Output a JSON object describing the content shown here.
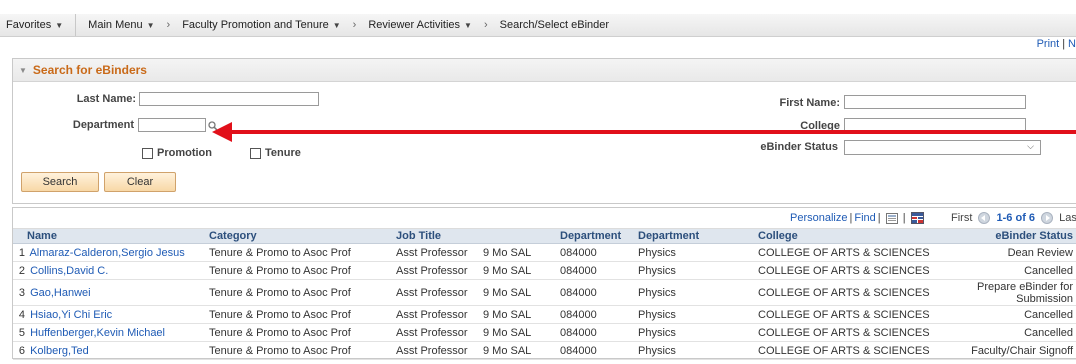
{
  "nav": {
    "favorites": "Favorites",
    "main_menu": "Main Menu",
    "crumbs": [
      "Faculty Promotion and Tenure",
      "Reviewer Activities",
      "Search/Select eBinder"
    ]
  },
  "print_bar": {
    "print": "Print",
    "next": "N"
  },
  "search": {
    "title": "Search for eBinders",
    "last_name_label": "Last Name:",
    "last_name_value": "",
    "first_name_label": "First Name:",
    "first_name_value": "",
    "department_label": "Department",
    "department_value": "",
    "college_label": "College",
    "college_value": "",
    "promotion_label": "Promotion",
    "tenure_label": "Tenure",
    "status_label": "eBinder Status",
    "status_value": "",
    "search_button": "Search",
    "clear_button": "Clear"
  },
  "grid": {
    "personalize": "Personalize",
    "find": "Find",
    "first": "First",
    "range": "1-6 of 6",
    "last": "Last",
    "columns": [
      "Name",
      "Category",
      "Job Title",
      "",
      "Department",
      "Department",
      "College",
      "eBinder Status"
    ],
    "rows": [
      {
        "num": "1",
        "name": "Almaraz-Calderon,Sergio Jesus",
        "category": "Tenure & Promo to Asoc Prof",
        "job_title": "Asst Professor",
        "pay": "9 Mo SAL",
        "dept_code": "084000",
        "dept": "Physics",
        "college": "COLLEGE OF ARTS & SCIENCES",
        "status": "Dean Review"
      },
      {
        "num": "2",
        "name": "Collins,David C.",
        "category": "Tenure & Promo to Asoc Prof",
        "job_title": "Asst Professor",
        "pay": "9 Mo SAL",
        "dept_code": "084000",
        "dept": "Physics",
        "college": "COLLEGE OF ARTS & SCIENCES",
        "status": "Cancelled"
      },
      {
        "num": "3",
        "name": "Gao,Hanwei",
        "category": "Tenure & Promo to Asoc Prof",
        "job_title": "Asst Professor",
        "pay": "9 Mo SAL",
        "dept_code": "084000",
        "dept": "Physics",
        "college": "COLLEGE OF ARTS & SCIENCES",
        "status": "Prepare eBinder for Submission"
      },
      {
        "num": "4",
        "name": "Hsiao,Yi Chi Eric",
        "category": "Tenure & Promo to Asoc Prof",
        "job_title": "Asst Professor",
        "pay": "9 Mo SAL",
        "dept_code": "084000",
        "dept": "Physics",
        "college": "COLLEGE OF ARTS & SCIENCES",
        "status": "Cancelled"
      },
      {
        "num": "5",
        "name": "Huffenberger,Kevin Michael",
        "category": "Tenure & Promo to Asoc Prof",
        "job_title": "Asst Professor",
        "pay": "9 Mo SAL",
        "dept_code": "084000",
        "dept": "Physics",
        "college": "COLLEGE OF ARTS & SCIENCES",
        "status": "Cancelled"
      },
      {
        "num": "6",
        "name": "Kolberg,Ted",
        "category": "Tenure & Promo to Asoc Prof",
        "job_title": "Asst Professor",
        "pay": "9 Mo SAL",
        "dept_code": "084000",
        "dept": "Physics",
        "college": "COLLEGE OF ARTS & SCIENCES",
        "status": "Faculty/Chair Signoff"
      }
    ]
  },
  "colors": {
    "accent": "#c96a19",
    "link": "#1f5bb5",
    "annotation_arrow": "#e1101a",
    "header_bg": "#dfe6ee"
  }
}
